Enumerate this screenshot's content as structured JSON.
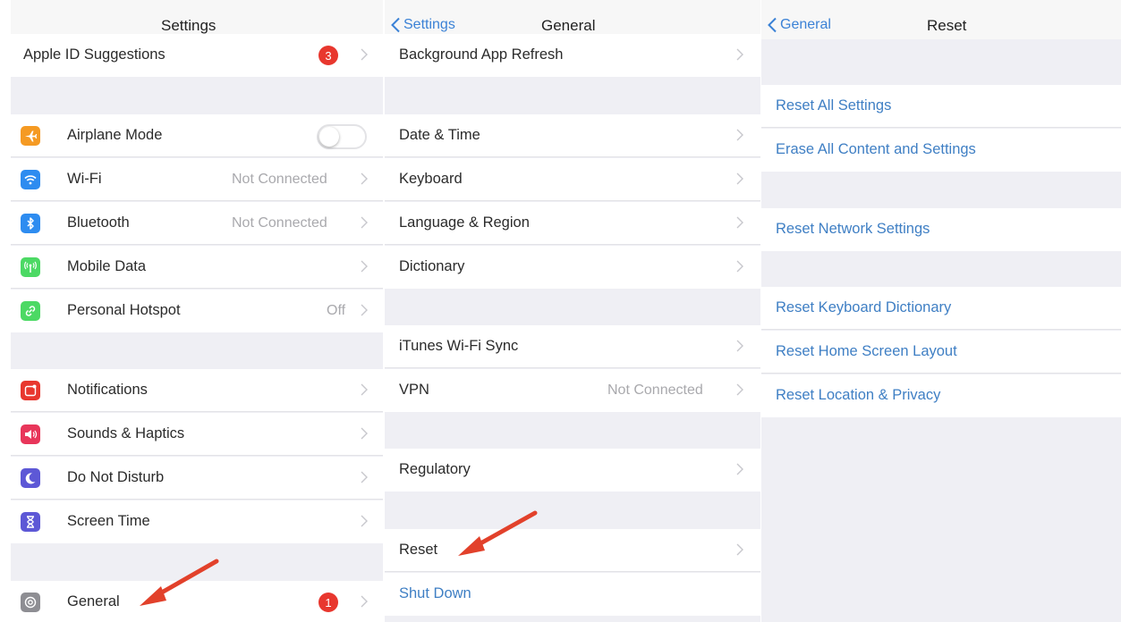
{
  "panel1": {
    "title": "Settings",
    "rows": {
      "apple_id": {
        "label": "Apple ID Suggestions",
        "badge": "3"
      },
      "airplane": {
        "label": "Airplane Mode",
        "toggle_on": false
      },
      "wifi": {
        "label": "Wi-Fi",
        "detail": "Not Connected"
      },
      "bluetooth": {
        "label": "Bluetooth",
        "detail": "Not Connected"
      },
      "mobile_data": {
        "label": "Mobile Data"
      },
      "hotspot": {
        "label": "Personal Hotspot",
        "detail": "Off"
      },
      "notifications": {
        "label": "Notifications"
      },
      "sounds": {
        "label": "Sounds & Haptics"
      },
      "dnd": {
        "label": "Do Not Disturb"
      },
      "screen_time": {
        "label": "Screen Time"
      },
      "general": {
        "label": "General",
        "badge": "1"
      }
    }
  },
  "panel2": {
    "back_label": "Settings",
    "title": "General",
    "rows": {
      "bg_refresh": {
        "label": "Background App Refresh"
      },
      "date_time": {
        "label": "Date & Time"
      },
      "keyboard": {
        "label": "Keyboard"
      },
      "language": {
        "label": "Language & Region"
      },
      "dictionary": {
        "label": "Dictionary"
      },
      "itunes": {
        "label": "iTunes Wi-Fi Sync"
      },
      "vpn": {
        "label": "VPN",
        "detail": "Not Connected"
      },
      "regulatory": {
        "label": "Regulatory"
      },
      "reset": {
        "label": "Reset"
      },
      "shutdown": {
        "label": "Shut Down"
      }
    }
  },
  "panel3": {
    "back_label": "General",
    "title": "Reset",
    "rows": {
      "reset_all": {
        "label": "Reset All Settings"
      },
      "erase_all": {
        "label": "Erase All Content and Settings"
      },
      "reset_network": {
        "label": "Reset Network Settings"
      },
      "reset_keyboard": {
        "label": "Reset Keyboard Dictionary"
      },
      "reset_home": {
        "label": "Reset Home Screen Layout"
      },
      "reset_location": {
        "label": "Reset Location & Privacy"
      }
    }
  },
  "colors": {
    "link_blue": "#3f7fc4",
    "badge_red": "#e8372e",
    "annotation_arrow": "#e2412b",
    "airplane_icon": "#f59a23",
    "wifi_icon": "#2e8cf0",
    "bluetooth_icon": "#2e8cf0",
    "mobile_data_icon": "#4cd964",
    "hotspot_icon": "#4cd964",
    "notifications_icon": "#e8372e",
    "sounds_icon": "#e8365a",
    "dnd_icon": "#5d58d6",
    "screen_time_icon": "#5d58d6",
    "general_icon": "#8e8e93"
  },
  "icons": {
    "airplane": "airplane-icon",
    "wifi": "wifi-icon",
    "bluetooth": "bluetooth-icon",
    "mobile_data": "antenna-icon",
    "hotspot": "hotspot-link-icon",
    "notifications": "notifications-icon",
    "sounds": "speaker-icon",
    "dnd": "moon-icon",
    "screen_time": "hourglass-icon",
    "general": "gear-icon"
  }
}
